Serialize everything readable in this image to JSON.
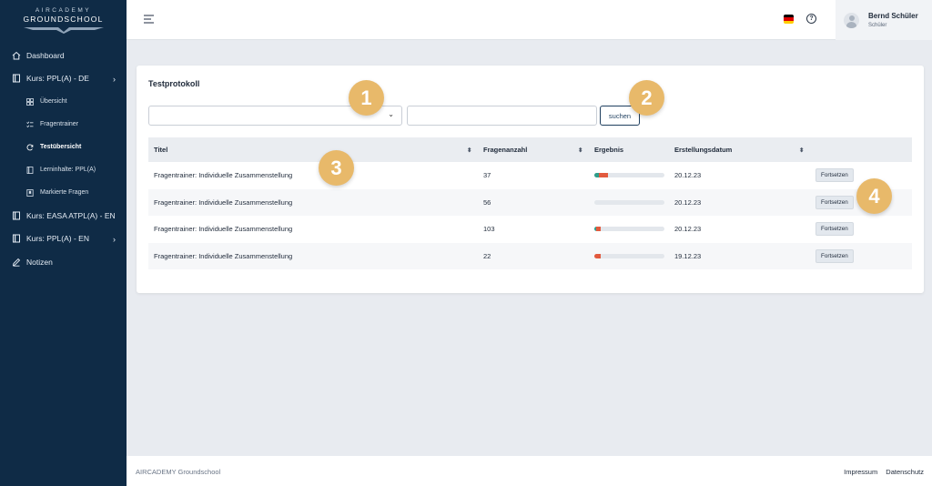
{
  "brand": {
    "line1": "AIRCADEMY",
    "line2": "GROUNDSCHOOL"
  },
  "sidebar": {
    "items": [
      {
        "label": "Dashboard",
        "icon": "home-icon"
      },
      {
        "label": "Kurs: PPL(A) - DE",
        "icon": "book-icon",
        "chevron": "›"
      },
      {
        "label": "Übersicht",
        "icon": "grid-icon"
      },
      {
        "label": "Fragentrainer",
        "icon": "list-check-icon"
      },
      {
        "label": "Testübersicht",
        "icon": "refresh-icon",
        "active": true
      },
      {
        "label": "Lerninhalte: PPL(A)",
        "icon": "book-icon"
      },
      {
        "label": "Markierte Fragen",
        "icon": "bookmark-icon"
      },
      {
        "label": "Kurs: EASA ATPL(A) - EN",
        "icon": "book-icon",
        "chevron": "›"
      },
      {
        "label": "Kurs: PPL(A) - EN",
        "icon": "book-icon",
        "chevron": "›"
      },
      {
        "label": "Notizen",
        "icon": "pencil-icon"
      }
    ]
  },
  "header": {
    "user_name": "Bernd Schüler",
    "user_role": "Schüler",
    "help_symbol": "?",
    "flag_colors": [
      "#000000",
      "#dd0000",
      "#ffce00"
    ]
  },
  "card": {
    "title": "Testprotokoll",
    "select_value": "",
    "search_value": "",
    "search_button": "suchen",
    "columns": {
      "title": "Titel",
      "count": "Fragenanzahl",
      "result": "Ergebnis",
      "date": "Erstellungsdatum"
    },
    "sort_symbol": "⬍",
    "rows": [
      {
        "title": "Fragentrainer: Individuelle Zusammenstellung",
        "count": "37",
        "date": "20.12.23",
        "action": "Fortsetzen",
        "correct": 0.07,
        "wrong": 0.12
      },
      {
        "title": "Fragentrainer: Individuelle Zusammenstellung",
        "count": "56",
        "date": "20.12.23",
        "action": "Fortsetzen",
        "correct": 0.0,
        "wrong": 0.0
      },
      {
        "title": "Fragentrainer: Individuelle Zusammenstellung",
        "count": "103",
        "date": "20.12.23",
        "action": "Fortsetzen",
        "correct": 0.02,
        "wrong": 0.07
      },
      {
        "title": "Fragentrainer: Individuelle Zusammenstellung",
        "count": "22",
        "date": "19.12.23",
        "action": "Fortsetzen",
        "correct": 0.0,
        "wrong": 0.09
      }
    ],
    "colors": {
      "correct": "#2f9e8b",
      "wrong": "#e25a3e"
    }
  },
  "markers": [
    "1",
    "2",
    "3",
    "4"
  ],
  "footer": {
    "brand": "AIRCADEMY Groundschool",
    "links": [
      "Impressum",
      "Datenschutz"
    ]
  }
}
